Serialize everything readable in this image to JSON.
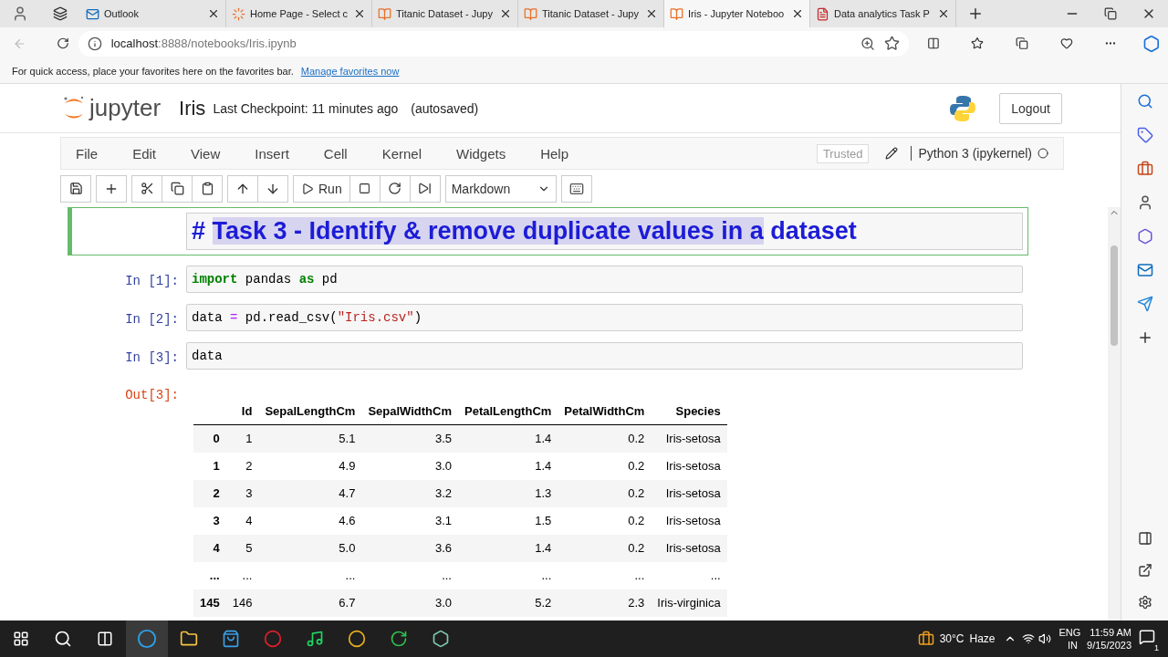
{
  "browser_tabs": [
    {
      "title": "Outlook",
      "selected": false
    },
    {
      "title": "Home Page - Select c",
      "selected": false
    },
    {
      "title": "Titanic Dataset - Jupy",
      "selected": false
    },
    {
      "title": "Titanic Dataset - Jupy",
      "selected": false
    },
    {
      "title": "Iris - Jupyter Noteboo",
      "selected": true
    },
    {
      "title": "Data analytics Task P",
      "selected": false
    }
  ],
  "address": {
    "host": "localhost",
    "rest": ":8888/notebooks/Iris.ipynb"
  },
  "favorites_bar": {
    "message": "For quick access, place your favorites here on the favorites bar.",
    "link": "Manage favorites now"
  },
  "jupyter": {
    "logo_text": "jupyter",
    "notebook_name": "Iris",
    "checkpoint": "Last Checkpoint: 11 minutes ago",
    "autosave": "(autosaved)",
    "logout": "Logout"
  },
  "menu": [
    "File",
    "Edit",
    "View",
    "Insert",
    "Cell",
    "Kernel",
    "Widgets",
    "Help"
  ],
  "trusted": "Trusted",
  "kernel": "Python 3 (ipykernel)",
  "toolbar": {
    "run": "Run",
    "cell_type": "Markdown"
  },
  "cells": [
    {
      "kind": "markdown",
      "selected": true,
      "parts": [
        {
          "text": "# ",
          "highlighted": false
        },
        {
          "text": "Task 3 - Identify & remove duplicate values in a",
          "highlighted": true
        },
        {
          "text": " dataset",
          "highlighted": false
        }
      ]
    },
    {
      "kind": "code",
      "selected": false,
      "prompt": "In [1]:",
      "tokens": [
        {
          "text": "import",
          "kind": "keyword"
        },
        {
          "text": " pandas ",
          "kind": "plain"
        },
        {
          "text": "as",
          "kind": "keyword"
        },
        {
          "text": " pd",
          "kind": "plain"
        }
      ]
    },
    {
      "kind": "code",
      "selected": false,
      "prompt": "In [2]:",
      "tokens": [
        {
          "text": "data ",
          "kind": "plain"
        },
        {
          "text": "=",
          "kind": "operator"
        },
        {
          "text": " pd.read_csv(",
          "kind": "plain"
        },
        {
          "text": "\"Iris.csv\"",
          "kind": "string"
        },
        {
          "text": ")",
          "kind": "plain"
        }
      ]
    },
    {
      "kind": "code",
      "selected": false,
      "prompt": "In [3]:",
      "tokens": [
        {
          "text": "data",
          "kind": "plain"
        }
      ]
    }
  ],
  "output": {
    "prompt": "Out[3]:",
    "columns": [
      "Id",
      "SepalLengthCm",
      "SepalWidthCm",
      "PetalLengthCm",
      "PetalWidthCm",
      "Species"
    ],
    "rows": [
      {
        "index": "0",
        "cells": [
          "1",
          "5.1",
          "3.5",
          "1.4",
          "0.2",
          "Iris-setosa"
        ]
      },
      {
        "index": "1",
        "cells": [
          "2",
          "4.9",
          "3.0",
          "1.4",
          "0.2",
          "Iris-setosa"
        ]
      },
      {
        "index": "2",
        "cells": [
          "3",
          "4.7",
          "3.2",
          "1.3",
          "0.2",
          "Iris-setosa"
        ]
      },
      {
        "index": "3",
        "cells": [
          "4",
          "4.6",
          "3.1",
          "1.5",
          "0.2",
          "Iris-setosa"
        ]
      },
      {
        "index": "4",
        "cells": [
          "5",
          "5.0",
          "3.6",
          "1.4",
          "0.2",
          "Iris-setosa"
        ]
      },
      {
        "index": "...",
        "cells": [
          "...",
          "...",
          "...",
          "...",
          "...",
          "..."
        ]
      },
      {
        "index": "145",
        "cells": [
          "146",
          "6.7",
          "3.0",
          "5.2",
          "2.3",
          "Iris-virginica"
        ]
      }
    ]
  },
  "tray": {
    "weather": "30°C",
    "condition": "Haze",
    "lang": "ENG",
    "region": "IN",
    "time": "11:59 AM",
    "date": "9/15/2023",
    "notifications": "1"
  }
}
